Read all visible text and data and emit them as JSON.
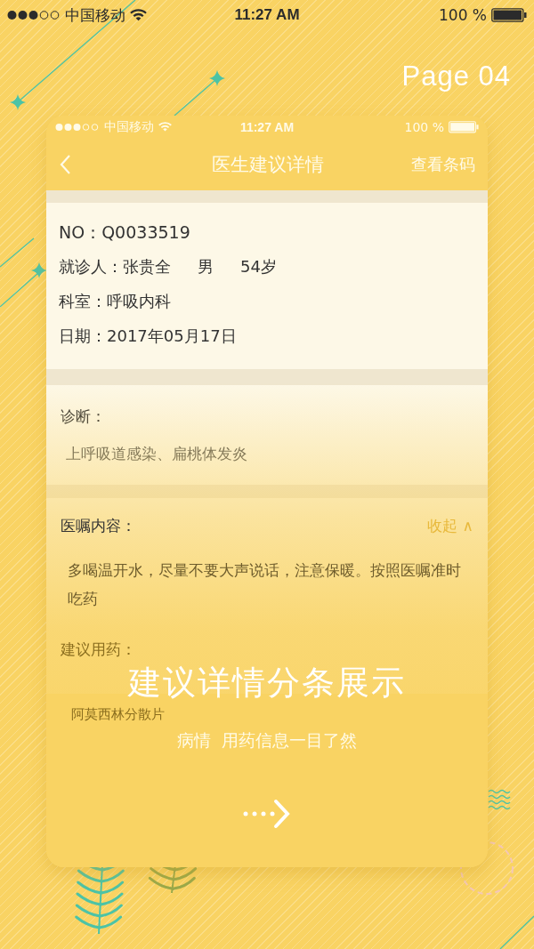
{
  "status_bar": {
    "carrier": "中国移动",
    "time": "11:27 AM",
    "battery": "100 %"
  },
  "page_label": "Page 04",
  "phone": {
    "status_bar": {
      "carrier": "中国移动",
      "time": "11:27 AM",
      "battery": "100 %"
    },
    "nav": {
      "title": "医生建议详情",
      "action": "查看条码"
    },
    "record": {
      "number": "NO：Q0033519",
      "patient": {
        "label": "就诊人：",
        "name": "张贵全",
        "gender": "男",
        "age": "54岁"
      },
      "department": "科室：呼吸内科",
      "date": "日期：2017年05月17日"
    },
    "diagnosis": {
      "title": "诊断：",
      "text": "上呼吸道感染、扁桃体发炎"
    },
    "advice": {
      "title": "医嘱内容：",
      "toggle": "收起 ∧",
      "text": "多喝温开水，尽量不要大声说话，注意保暖。按照医嘱准时吃药"
    },
    "medication": {
      "title": "建议用药：",
      "items": [
        "阿莫西林分散片"
      ]
    }
  },
  "overlay": {
    "headline": "建议详情分条展示",
    "subtitle": "病情  用药信息一目了然"
  }
}
